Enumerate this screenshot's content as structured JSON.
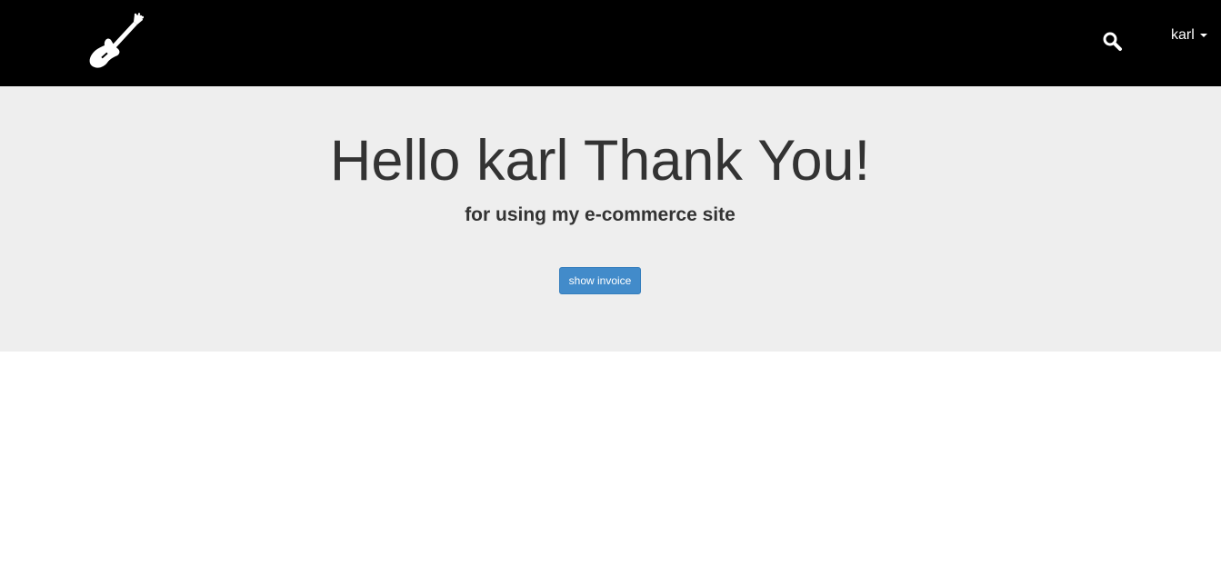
{
  "navbar": {
    "logo_icon": "guitar-icon",
    "search_icon": "search-icon",
    "user_name": "karl",
    "dropdown_icon": "caret-down-icon"
  },
  "hero": {
    "title": "Hello karl Thank You!",
    "subtitle": "for using my e-commerce site",
    "invoice_button_label": "show invoice"
  },
  "colors": {
    "navbar_bg": "#000000",
    "hero_bg": "#eeeeee",
    "primary_button": "#428bca",
    "text": "#333333"
  }
}
